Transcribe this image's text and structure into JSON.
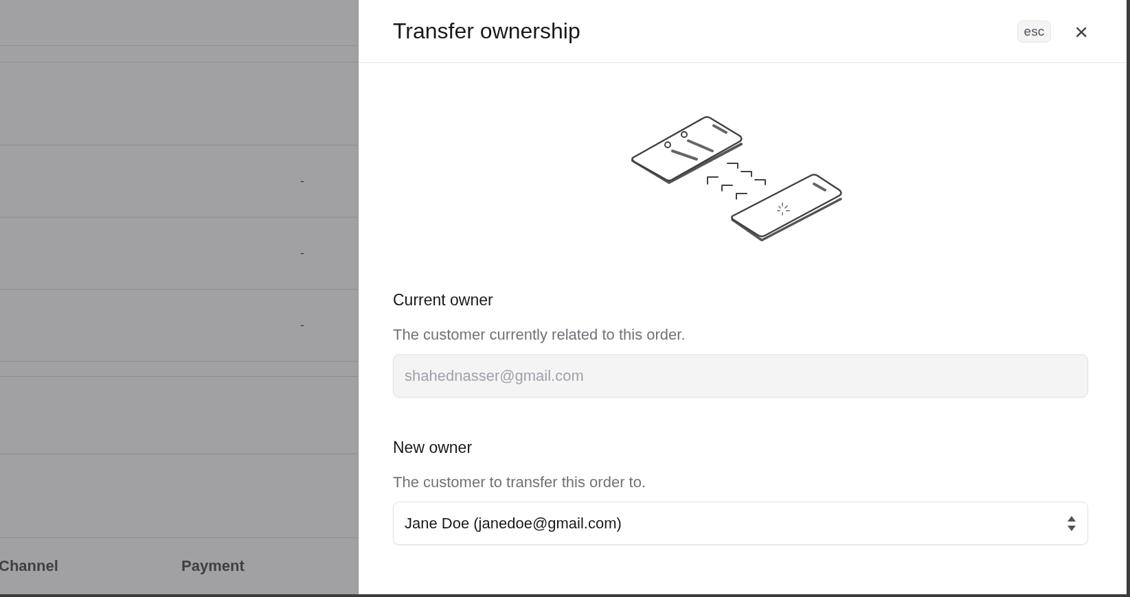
{
  "background_table": {
    "rows": [
      {
        "value": ""
      },
      {
        "value": ""
      },
      {
        "value": ""
      },
      {
        "value": "-"
      },
      {
        "value": "-"
      },
      {
        "value": "-"
      },
      {
        "value": ""
      },
      {
        "value": ""
      },
      {
        "value": ""
      }
    ],
    "columns": [
      "Channel",
      "Payment"
    ]
  },
  "drawer": {
    "title": "Transfer ownership",
    "shortcut": "esc",
    "close": "×",
    "current_owner": {
      "label": "Current owner",
      "description": "The customer currently related to this order.",
      "value": "shahednasser@gmail.com",
      "disabled": true
    },
    "new_owner": {
      "label": "New owner",
      "description": "The customer to transfer this order to.",
      "value": "Jane Doe (janedoe@gmail.com)",
      "disabled": false
    }
  }
}
